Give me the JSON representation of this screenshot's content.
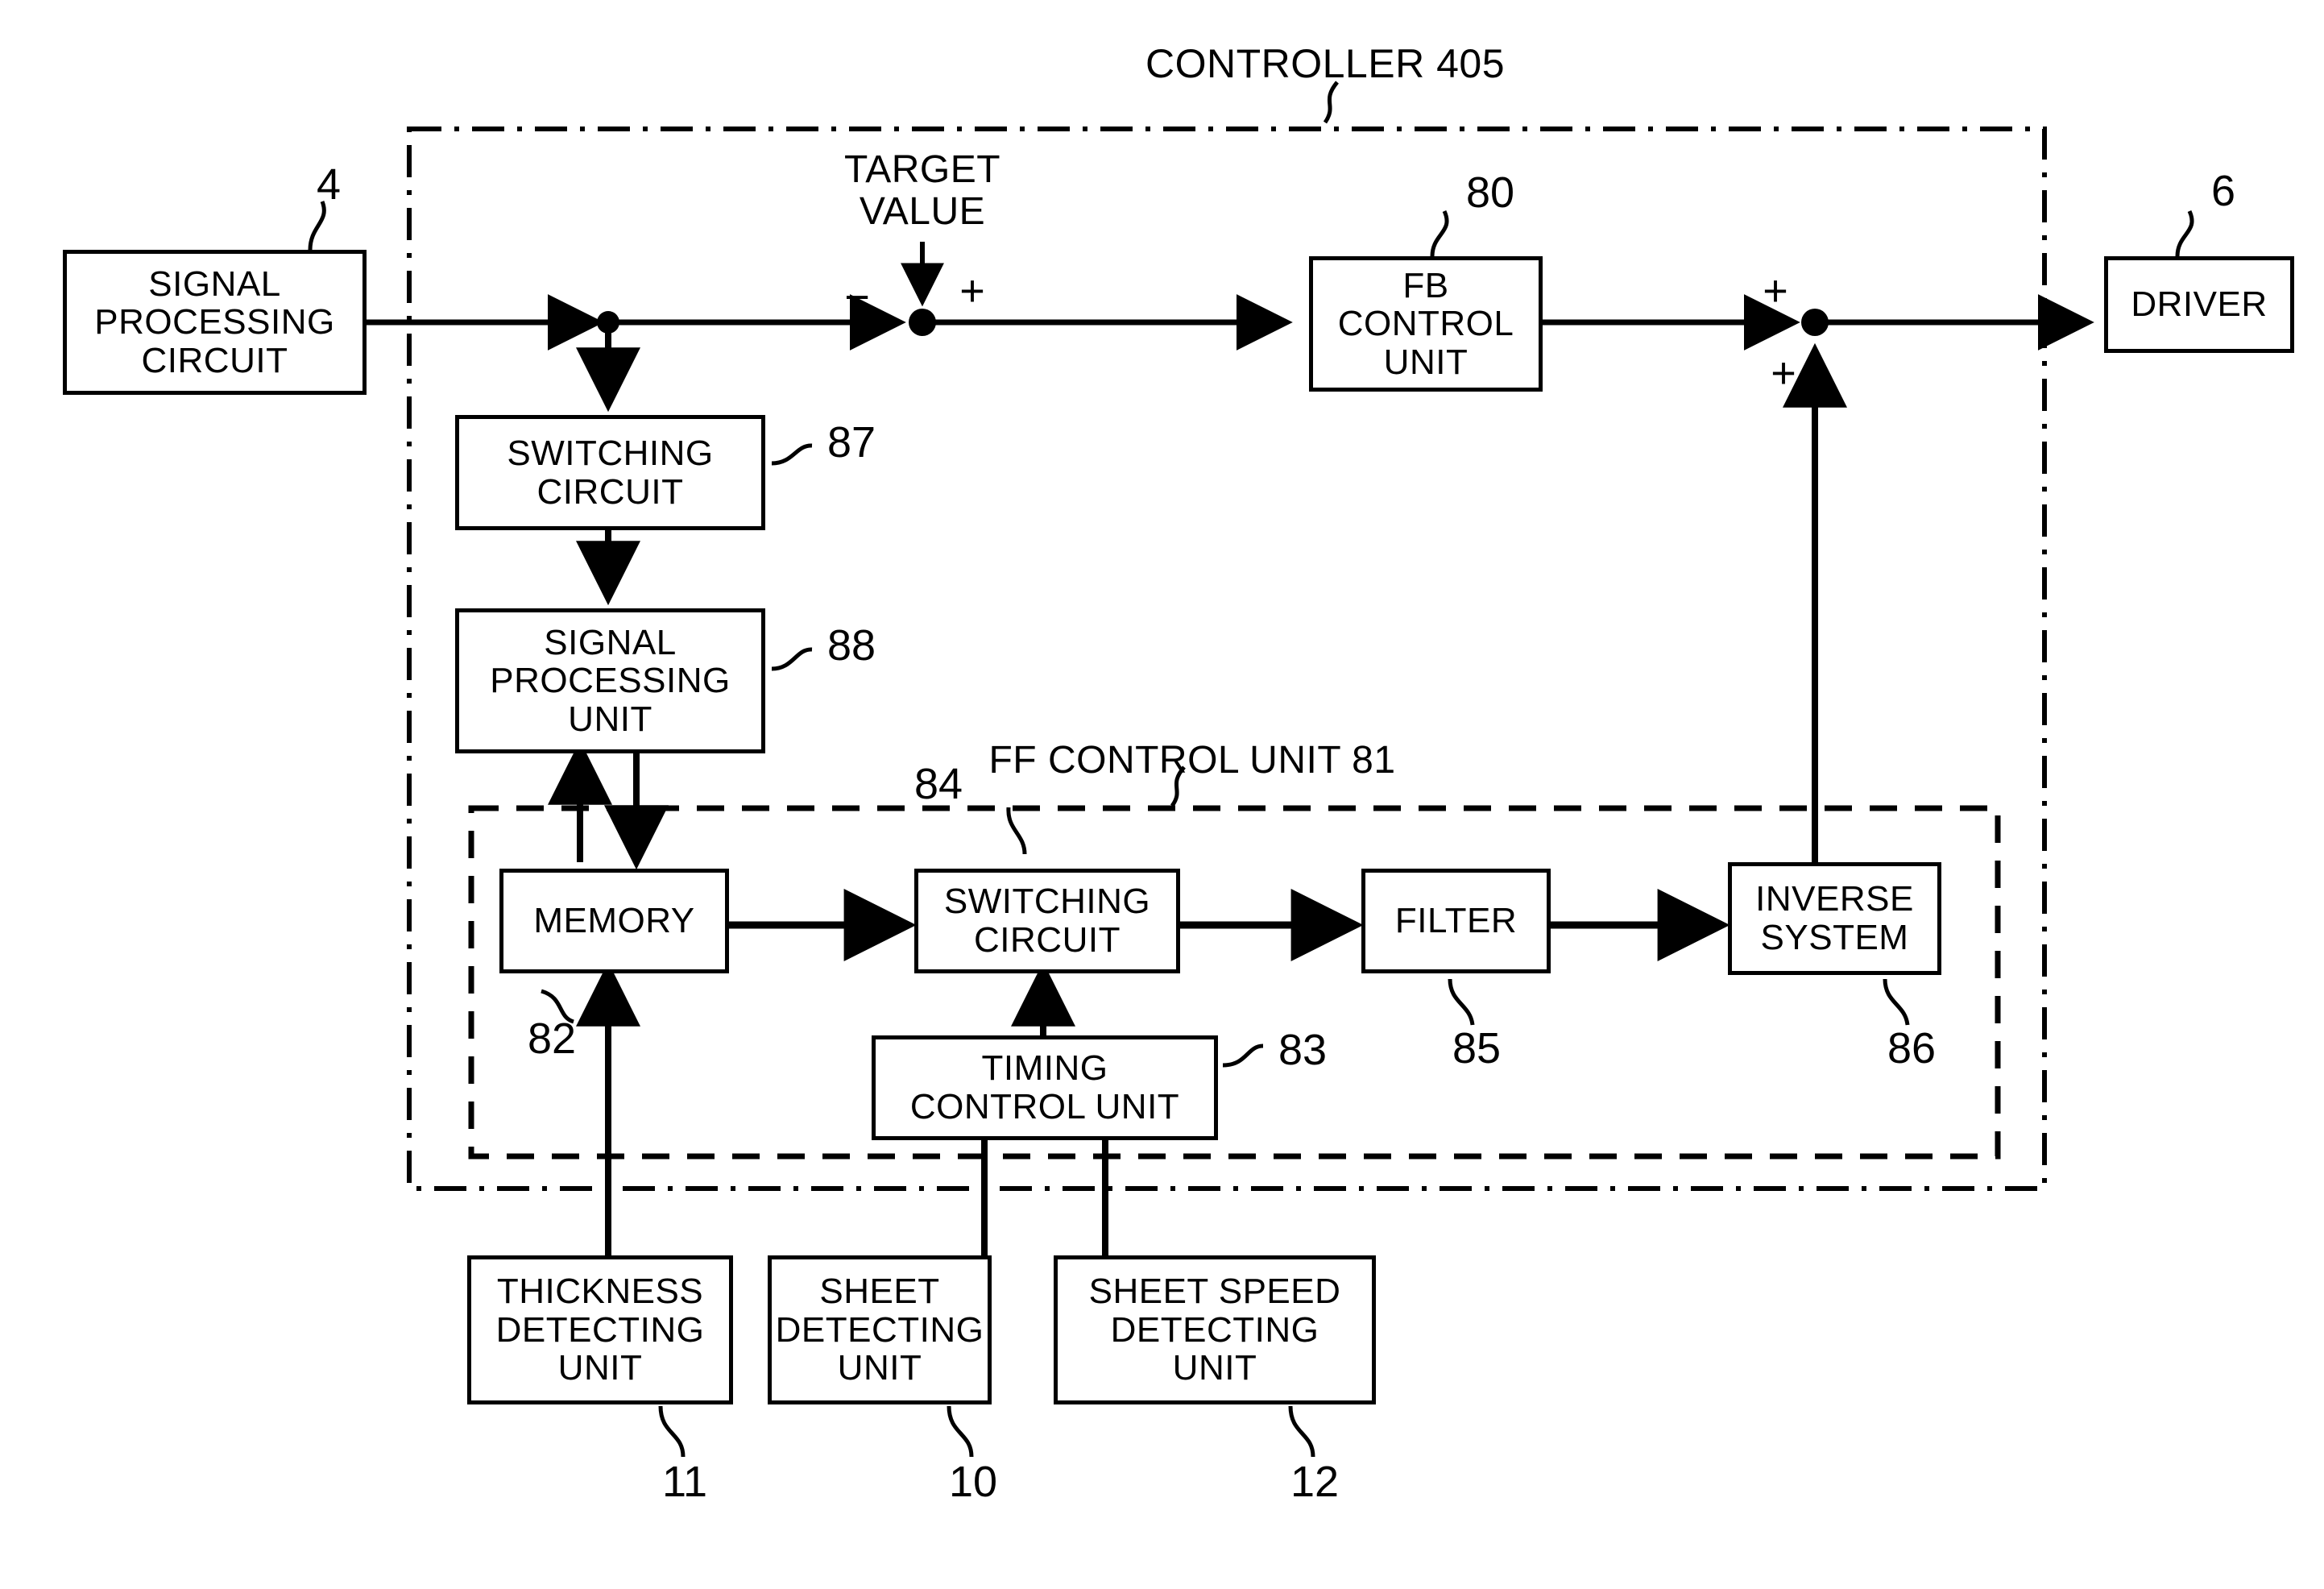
{
  "figure": {
    "title": "CONTROLLER 405",
    "inner_group_title": "FF CONTROL UNIT 81",
    "target_value_label": "TARGET\nVALUE"
  },
  "boxes": {
    "signal_processing_circuit": {
      "label": "SIGNAL\nPROCESSING\nCIRCUIT",
      "ref": "4"
    },
    "fb_control_unit": {
      "label": "FB\nCONTROL\nUNIT",
      "ref": "80"
    },
    "driver": {
      "label": "DRIVER",
      "ref": "6"
    },
    "switching_circuit_87": {
      "label": "SWITCHING\nCIRCUIT",
      "ref": "87"
    },
    "signal_processing_unit_88": {
      "label": "SIGNAL\nPROCESSING\nUNIT",
      "ref": "88"
    },
    "memory": {
      "label": "MEMORY",
      "ref": "82"
    },
    "switching_circuit_84": {
      "label": "SWITCHING\nCIRCUIT",
      "ref": "84"
    },
    "timing_control_unit": {
      "label": "TIMING\nCONTROL UNIT",
      "ref": "83"
    },
    "filter": {
      "label": "FILTER",
      "ref": "85"
    },
    "inverse_system": {
      "label": "INVERSE\nSYSTEM",
      "ref": "86"
    },
    "thickness_detecting_unit": {
      "label": "THICKNESS\nDETECTING\nUNIT",
      "ref": "11"
    },
    "sheet_detecting_unit": {
      "label": "SHEET\nDETECTING\nUNIT",
      "ref": "10"
    },
    "sheet_speed_detecting_unit": {
      "label": "SHEET SPEED\nDETECTING\nUNIT",
      "ref": "12"
    }
  },
  "signs": {
    "summing_minus": "−",
    "summing_plus": "+",
    "adder_plus_in": "+",
    "adder_plus_fb": "+"
  },
  "colors": {
    "line": "#000000",
    "background": "#ffffff"
  }
}
